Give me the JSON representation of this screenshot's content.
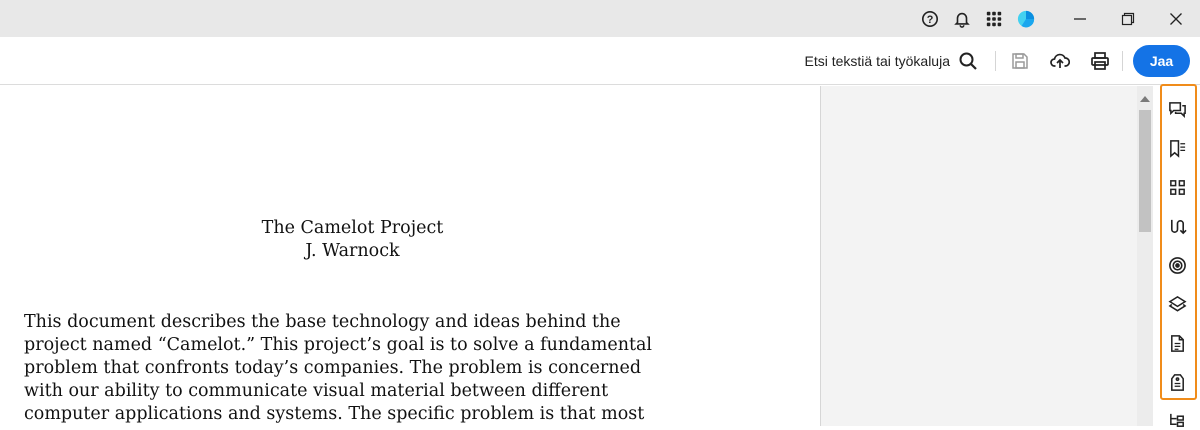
{
  "titlebar": {
    "icons": [
      "help-icon",
      "bell-icon",
      "apps-grid-icon",
      "profile-avatar"
    ],
    "avatar_colors": [
      "#0b8fe0",
      "#43d1f0"
    ]
  },
  "toolbar": {
    "search_label": "Etsi tekstiä tai työkaluja",
    "share_label": "Jaa",
    "accent": "#1473e6"
  },
  "document": {
    "title": "The Camelot Project",
    "author": "J. Warnock",
    "paragraph_lines": [
      "This document describes the base technology and ideas behind the",
      "project named “Camelot.” This project’s goal is to solve a fundamental",
      "problem that confronts today’s companies. The problem is concerned",
      "with our ability to communicate visual material between different",
      "computer applications and systems. The specific problem is that most"
    ]
  },
  "right_rail": {
    "highlight_color": "#f08c1a",
    "icons": [
      "comment-icon",
      "bookmark-icon",
      "thumbnails-icon",
      "compare-icon",
      "fill-sign-icon",
      "layers-icon",
      "document-icon",
      "accessibility-tag-icon",
      "hierarchy-icon"
    ]
  }
}
